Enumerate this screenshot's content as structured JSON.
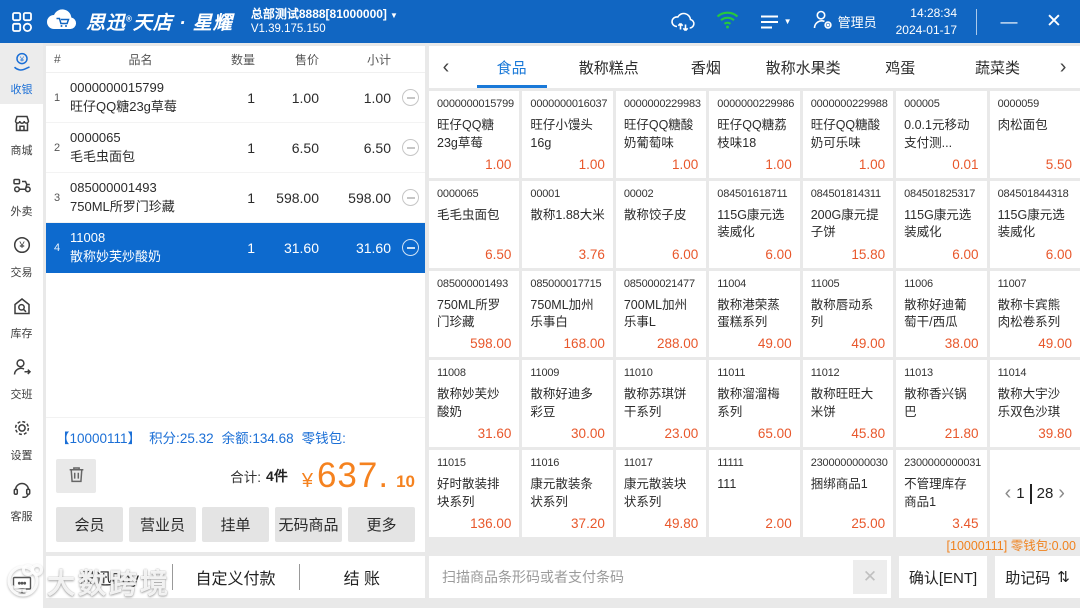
{
  "topbar": {
    "brand": {
      "a": "思迅",
      "reg": "®",
      "b": "天店",
      "dot": "·",
      "c": "星耀"
    },
    "store": "总部测试8888[81000000]",
    "store_caret": "▼",
    "version": "V1.39.175.150",
    "admin": "管理员",
    "time": "14:28:34",
    "date": "2024-01-17",
    "minimize": "—",
    "close": "✕"
  },
  "sidebar": {
    "items": [
      {
        "label": "收银",
        "active": true
      },
      {
        "label": "商城"
      },
      {
        "label": "外卖"
      },
      {
        "label": "交易"
      },
      {
        "label": "库存"
      },
      {
        "label": "交班"
      },
      {
        "label": "设置"
      },
      {
        "label": "客服"
      }
    ]
  },
  "cart": {
    "columns": [
      "#",
      "品名",
      "数量",
      "售价",
      "小计"
    ],
    "rows": [
      {
        "idx": "1",
        "code": "0000000015799",
        "name": "旺仔QQ糖23g草莓",
        "qty": "1",
        "price": "1.00",
        "subtotal": "1.00"
      },
      {
        "idx": "2",
        "code": "0000065",
        "name": "毛毛虫面包",
        "qty": "1",
        "price": "6.50",
        "subtotal": "6.50"
      },
      {
        "idx": "3",
        "code": "085000001493",
        "name": "750ML所罗门珍藏",
        "qty": "1",
        "price": "598.00",
        "subtotal": "598.00"
      },
      {
        "idx": "4",
        "code": "11008",
        "name": "散称妙芙炒酸奶",
        "qty": "1",
        "price": "31.60",
        "subtotal": "31.60",
        "selected": true
      }
    ]
  },
  "member": {
    "id": "【10000111】",
    "points": "积分:25.32",
    "balance": "余额:134.68",
    "wallet": "零钱包:"
  },
  "summary": {
    "total_label": "合计:",
    "count": "4件",
    "currency": "¥",
    "amount_main": "637.",
    "amount_cents": "10"
  },
  "actions": [
    "会员",
    "营业员",
    "挂单",
    "无码商品",
    "更多"
  ],
  "categories": {
    "prev": "‹",
    "next": "›",
    "tabs": [
      {
        "label": "食品",
        "active": true
      },
      {
        "label": "散称糕点"
      },
      {
        "label": "香烟"
      },
      {
        "label": "散称水果类"
      },
      {
        "label": "鸡蛋"
      },
      {
        "label": "蔬菜类"
      }
    ]
  },
  "products": {
    "items": [
      {
        "code": "0000000015799",
        "name": "旺仔QQ糖23g草莓",
        "price": "1.00"
      },
      {
        "code": "0000000016037",
        "name": "旺仔小馒头16g",
        "price": "1.00"
      },
      {
        "code": "0000000229983",
        "name": "旺仔QQ糖酸奶葡萄味",
        "price": "1.00"
      },
      {
        "code": "0000000229986",
        "name": "旺仔QQ糖荔枝味18",
        "price": "1.00"
      },
      {
        "code": "0000000229988",
        "name": "旺仔QQ糖酸奶可乐味",
        "price": "1.00"
      },
      {
        "code": "000005",
        "name": "0.0.1元移动支付测...",
        "price": "0.01"
      },
      {
        "code": "0000059",
        "name": "肉松面包",
        "price": "5.50"
      },
      {
        "code": "0000065",
        "name": "毛毛虫面包",
        "price": "6.50"
      },
      {
        "code": "00001",
        "name": "散称1.88大米",
        "price": "3.76"
      },
      {
        "code": "00002",
        "name": "散称饺子皮",
        "price": "6.00"
      },
      {
        "code": "084501618711",
        "name": "115G康元选装威化",
        "price": "6.00"
      },
      {
        "code": "084501814311",
        "name": "200G康元提子饼",
        "price": "15.80"
      },
      {
        "code": "084501825317",
        "name": "115G康元选装威化",
        "price": "6.00"
      },
      {
        "code": "084501844318",
        "name": "115G康元选装威化",
        "price": "6.00"
      },
      {
        "code": "085000001493",
        "name": "750ML所罗门珍藏",
        "price": "598.00"
      },
      {
        "code": "085000017715",
        "name": "750ML加州乐事白",
        "price": "168.00"
      },
      {
        "code": "085000021477",
        "name": "700ML加州乐事L",
        "price": "288.00"
      },
      {
        "code": "11004",
        "name": "散称港荣蒸蛋糕系列",
        "price": "49.00"
      },
      {
        "code": "11005",
        "name": "散称唇动系列",
        "price": "49.00"
      },
      {
        "code": "11006",
        "name": "散称好迪葡萄干/西瓜",
        "price": "38.00"
      },
      {
        "code": "11007",
        "name": "散称卡宾熊肉松卷系列",
        "price": "49.00"
      },
      {
        "code": "11008",
        "name": "散称妙芙炒酸奶",
        "price": "31.60"
      },
      {
        "code": "11009",
        "name": "散称好迪多彩豆",
        "price": "30.00"
      },
      {
        "code": "11010",
        "name": "散称苏琪饼干系列",
        "price": "23.00"
      },
      {
        "code": "11011",
        "name": "散称溜溜梅系列",
        "price": "65.00"
      },
      {
        "code": "11012",
        "name": "散称旺旺大米饼",
        "price": "45.80"
      },
      {
        "code": "11013",
        "name": "散称香兴锅巴",
        "price": "21.80"
      },
      {
        "code": "11014",
        "name": "散称大宇沙乐双色沙琪",
        "price": "39.80"
      },
      {
        "code": "11015",
        "name": "好时散装排块系列",
        "price": "136.00"
      },
      {
        "code": "11016",
        "name": "康元散装条状系列",
        "price": "37.20"
      },
      {
        "code": "11017",
        "name": "康元散装块状系列",
        "price": "49.80"
      },
      {
        "code": "11111",
        "name": "111",
        "price": "2.00"
      },
      {
        "code": "2300000000030",
        "name": "捆绑商品1",
        "price": "25.00"
      },
      {
        "code": "2300000000031",
        "name": "不管理库存商品1",
        "price": "3.45"
      }
    ]
  },
  "pagination": {
    "prev": "‹",
    "current": "1",
    "total": "28",
    "next": "›"
  },
  "status_line": "[10000111]  零钱包:0.00",
  "paybar": {
    "options": [
      "思迅Pay",
      "自定义付款",
      "结  账"
    ]
  },
  "scanbar": {
    "placeholder": "扫描商品条形码或者支付条码",
    "clear": "✕",
    "confirm": "确认[ENT]",
    "mnemonic": "助记码",
    "mnemonic_icon": "⇅"
  },
  "watermark": {
    "text": "大数跨境"
  },
  "colors": {
    "topbar_blue": "#1166c2",
    "selected_blue": "#0d6ace",
    "tab_active_blue": "#1a79d8",
    "member_blue": "#1b6fd6",
    "price_orange": "#e8572b",
    "total_orange": "#f5821f",
    "wifi_green": "#25c93d"
  },
  "icons": {
    "apps-grid-icon": "grid of app tiles",
    "brand-cloud-icon": "cloud with shopping cart",
    "cloud-sync-icon": "cloud with up-down arrows",
    "wifi-icon": "green wifi arcs",
    "task-list-icon": "list lines with caret",
    "admin-user-icon": "person with gear",
    "cashier-icon": "hand holding yen coin",
    "mall-icon": "storefront",
    "takeout-icon": "delivery scooter",
    "trade-icon": "yen circle",
    "inventory-icon": "house with magnifier",
    "shift-icon": "person with arrow",
    "settings-icon": "gear",
    "support-icon": "headset",
    "customer-display-icon": "monitor",
    "trash-icon": "trash can",
    "remove-item-icon": "circled minus",
    "clear-input-icon": "x mark",
    "mnemonic-sort-icon": "up-down arrows"
  }
}
